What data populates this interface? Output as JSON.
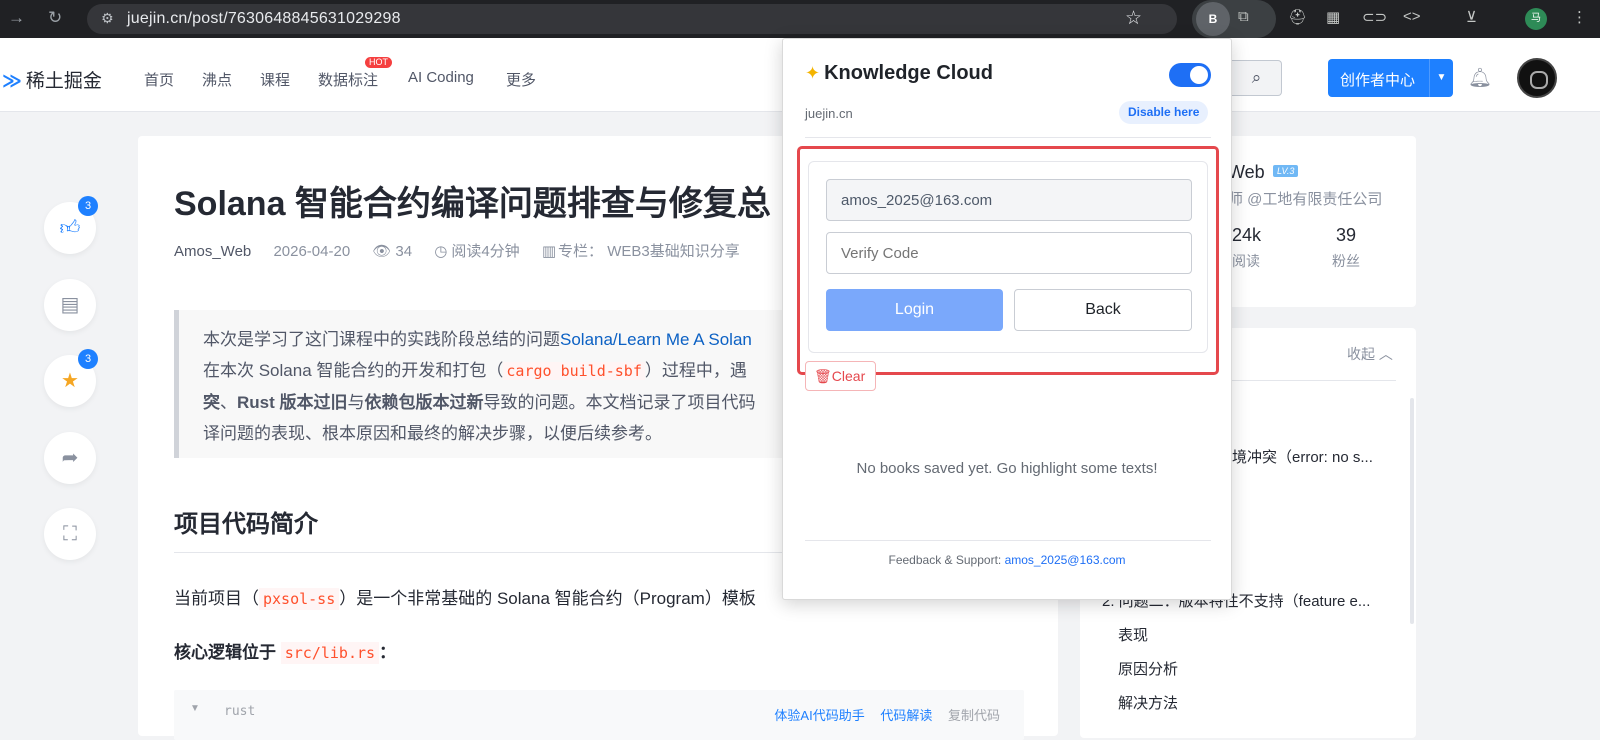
{
  "browser": {
    "url": "juejin.cn/post/7630648845631029298",
    "extension_label": "B",
    "profile_label": "马"
  },
  "site": {
    "logo_text": "稀土掘金",
    "nav": [
      "首页",
      "沸点",
      "课程",
      "数据标注",
      "AI Coding",
      "更多"
    ],
    "hot_badge": "HOT",
    "creator_button": "创作者中心"
  },
  "sidebar": {
    "like_count": "3",
    "star_count": "3"
  },
  "article": {
    "title": "Solana 智能合约编译问题排查与修复总",
    "author": "Amos_Web",
    "date": "2026-04-20",
    "views": "34",
    "read_time": "阅读4分钟",
    "column": "专栏： WEB3基础知识分享",
    "quote_line1_pre": "本次是学习了这门课程中的实践阶段总结的问题",
    "quote_line1_link": "Solana/Learn Me A Solan",
    "quote_line2_pre": "在本次 Solana 智能合约的开发和打包（",
    "quote_line2_code": "cargo build-sbf",
    "quote_line2_post": "）过程中，遇",
    "quote_line3_a": "突",
    "quote_line3_b": "、",
    "quote_line3_c": "Rust 版本过旧",
    "quote_line3_d": "与",
    "quote_line3_e": "依赖包版本过新",
    "quote_line3_f": "导致的问题。本文档记录了项目代码",
    "quote_line4": "译问题的表现、根本原因和最终的解决步骤，以便后续参考。",
    "section_heading": "项目代码简介",
    "p1_pre": "当前项目（",
    "p1_code": "pxsol-ss",
    "p1_post": "）是一个非常基础的 Solana 智能合约（Program）模板",
    "p2_pre": "核心逻辑位于",
    "p2_code": "src/lib.rs",
    "p2_post": "：",
    "code_lang": "rust",
    "code_tool_ai": "体验AI代码助手",
    "code_tool_explain": "代码解读",
    "code_tool_copy": "复制代码"
  },
  "author_card": {
    "name_fragment": "Web",
    "level": "LV.3",
    "company": "师 @工地有限责任公司",
    "reads_value": "24k",
    "reads_label": "阅读",
    "fans_value": "39",
    "fans_label": "粉丝"
  },
  "toc": {
    "collapse": "收起",
    "item1": "境冲突（error: no s...",
    "item2": "2. 问题二：版本特性不支持（feature e...",
    "sub1": "表现",
    "sub2": "原因分析",
    "sub3": "解决方法"
  },
  "popup": {
    "title": "Knowledge Cloud",
    "enabled": true,
    "domain": "juejin.cn",
    "disable_button": "Disable here",
    "email_value": "amos_2025@163.com",
    "code_placeholder": "Verify Code",
    "login_button": "Login",
    "back_button": "Back",
    "clear_button": "Clear",
    "empty_message": "No books saved yet. Go highlight some texts!",
    "footer_label": "Feedback & Support:",
    "footer_email": "amos_2025@163.com",
    "highlight_color": "#e5484d",
    "accent_color": "#1e6ff5"
  }
}
